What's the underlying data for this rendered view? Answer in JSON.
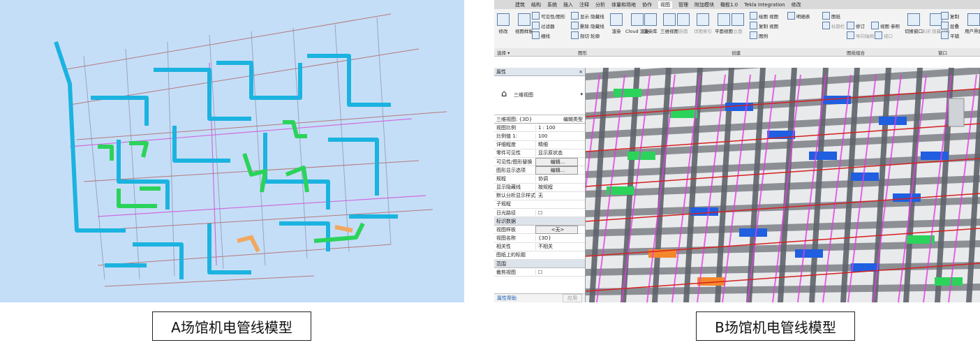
{
  "captions": {
    "a": "A场馆机电管线模型",
    "b": "B场馆机电管线模型"
  },
  "revit": {
    "tabs": [
      "建筑",
      "结构",
      "系统",
      "插入",
      "注释",
      "分析",
      "体量和场地",
      "协作",
      "视图",
      "管理",
      "附加模块",
      "橄榄1.0",
      "Tekla Integration",
      "修改"
    ],
    "active_tab": "视图",
    "ribbon": {
      "modify": "修改",
      "view_templates": "视图样板",
      "visibility": "可见性/图形",
      "filters": "过滤器",
      "thin_lines": "细线",
      "show_hidden": "显示 隐藏线",
      "remove_hidden": "删除 隐藏线",
      "cut_profile": "剖切 轮廓",
      "render": "渲染",
      "cloud": "Cloud 渲染",
      "render_gallery": "渲染库",
      "3d_view": "三维视图",
      "section": "剖面",
      "callout": "详图索引",
      "plan_views": "平面视图",
      "elevation": "立面",
      "drafting": "绘图 视图",
      "duplicate": "复制 视图",
      "legends": "图例",
      "schedules": "明细表",
      "sheet": "图纸",
      "title_block": "标题栏",
      "revisions": "修订",
      "view_ref": "视图 参照",
      "guide_grid": "导向轴网",
      "viewports": "视口",
      "switch_windows": "切换窗口",
      "close_hidden": "关闭 隐藏对象",
      "replicate": "复制",
      "cascade": "层叠",
      "tile": "平铺",
      "user_interface": "用户界面"
    },
    "groups": [
      "选择 ▾",
      "图形",
      "创建",
      "图纸组合",
      "窗口"
    ],
    "properties": {
      "title": "属性",
      "close": "×",
      "type_name": "三维视图",
      "selector": "三维视图: {3D}",
      "edit_type": "编辑类型",
      "rows": [
        {
          "k": "视图比例",
          "v": "1 : 100"
        },
        {
          "k": "比例值 1:",
          "v": "100"
        },
        {
          "k": "详细程度",
          "v": "精细"
        },
        {
          "k": "零件可见性",
          "v": "显示原状态"
        },
        {
          "k": "可见性/图形替换",
          "v": "编辑...",
          "button": true
        },
        {
          "k": "图形显示选项",
          "v": "编辑...",
          "button": true
        },
        {
          "k": "规程",
          "v": "协调"
        },
        {
          "k": "显示隐藏线",
          "v": "按规程"
        },
        {
          "k": "默认分析显示样式",
          "v": "无"
        },
        {
          "k": "子规程",
          "v": ""
        },
        {
          "k": "日光路径",
          "v": "☐"
        }
      ],
      "cat_identity": "标识数据",
      "rows2": [
        {
          "k": "视图样板",
          "v": "<无>",
          "button": true
        },
        {
          "k": "视图名称",
          "v": "{3D}"
        },
        {
          "k": "相关性",
          "v": "不相关"
        },
        {
          "k": "图纸上的标题",
          "v": ""
        }
      ],
      "cat_extents": "范围",
      "rows3": [
        {
          "k": "裁剪视图",
          "v": "☐"
        }
      ],
      "help": "属性帮助",
      "apply": "应用"
    }
  },
  "colors": {
    "sky": "#c5def7",
    "cyan": "#1bb3e0",
    "green": "#2bd35b",
    "magenta": "#e23fe0",
    "blue": "#1f5fe0",
    "orange": "#f5872b",
    "beam": "#7b7f85"
  }
}
